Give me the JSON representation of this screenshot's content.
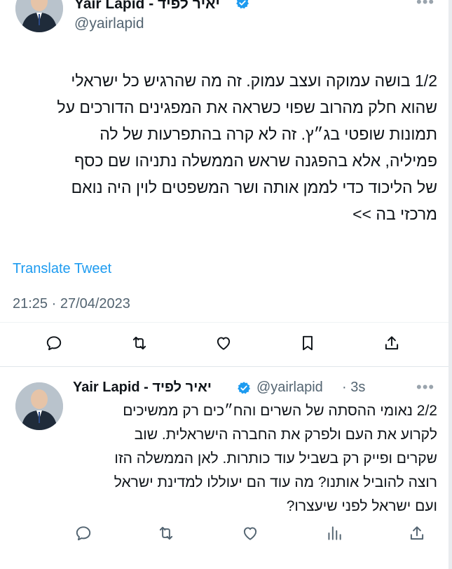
{
  "tweet1": {
    "author_name": "Yair Lapid - יאיר לפיד",
    "handle": "@yairlapid",
    "text_lines": [
      "1/2 בושה עמוקה ועצב עמוק. זה מה שהרגיש כל ישראלי",
      "שהוא חלק מהרוב שפוי כשראה את המפגינים הדורכים על",
      "תמונות שופטי בג״ץ. זה לא קרה בהתפרעות של לה",
      "פמיליה, אלא בהפגנה שראש הממשלה נתניהו שם כסף",
      "של הליכוד כדי לממן אותה ושר המשפטים לוין היה נואם",
      "מרכזי בה >>"
    ],
    "translate_label": "Translate Tweet",
    "timestamp": "21:25 · 27/04/2023",
    "more_icon": "more-dots-icon",
    "actions": [
      "reply-icon",
      "retweet-icon",
      "like-icon",
      "bookmark-icon",
      "share-icon"
    ]
  },
  "tweet2": {
    "author_name": "Yair Lapid - יאיר לפיד",
    "handle": "@yairlapid",
    "time_ago": "· 3s",
    "text_lines": [
      "2/2 נאומי ההסתה של השרים והח״כים רק ממשיכים",
      "לקרוע את העם ולפרק את החברה הישראלית. שוב",
      "שקרים ופייק רק בשביל עוד כותרות. לאן הממשלה הזו",
      "רוצה להוביל אותנו? מה עוד הם יעוללו למדינת ישראל",
      "ועם ישראל לפני שיעצרו?"
    ],
    "more_icon": "more-dots-icon",
    "actions": [
      "reply-icon",
      "retweet-icon",
      "like-icon",
      "views-icon",
      "share-icon"
    ]
  },
  "colors": {
    "link_blue": "#1d9bf0",
    "verified_blue": "#1d9bf0",
    "text": "#0f1419",
    "muted": "#536471"
  }
}
